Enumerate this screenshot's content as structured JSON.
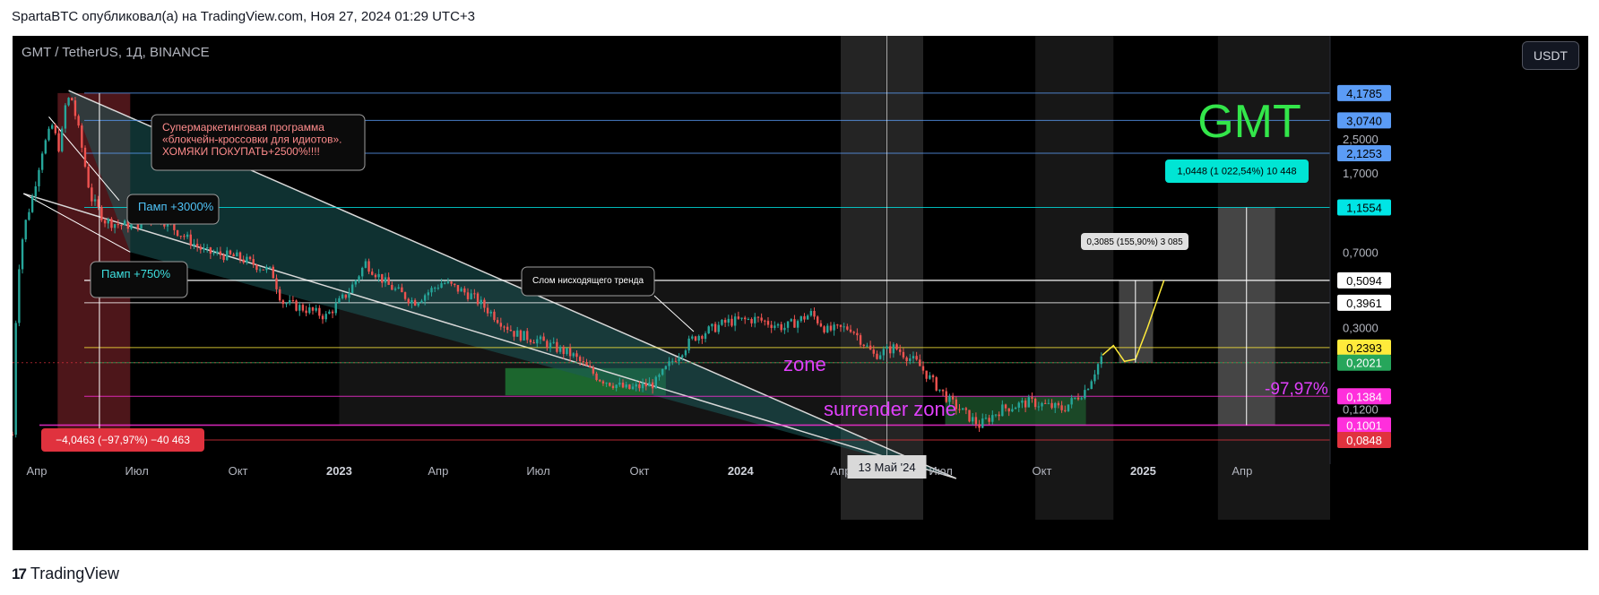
{
  "header": {
    "caption": "SpartaBTC опубликовал(а) на TradingView.com, Ноя 27, 2024 01:29 UTC+3"
  },
  "chart": {
    "symbol": "GMT / TetherUS, 1Д, BINANCE",
    "currency_button": "USDT",
    "watermark": "GMT"
  },
  "footer": {
    "brand": "TradingView",
    "logo_glyph": "17"
  },
  "colors": {
    "background": "#000000",
    "candle_up": "#26a69a",
    "candle_down": "#ef5350",
    "wedge_fill": "#1c5a5a",
    "accent_cyan": "#00e5d4",
    "accent_magenta": "#ff2fdc",
    "accent_yellow": "#ffeb3b",
    "label_blue": "#2962ff",
    "label_green": "#26a65b",
    "label_red": "#e0323e",
    "watermark_green": "#33e64a"
  },
  "chart_data": {
    "type": "line",
    "title": "GMT / TetherUS, 1Д, BINANCE",
    "yscale": "log",
    "ylim": [
      0.07,
      6.5
    ],
    "xlim": [
      "2022-03-10",
      "2025-06-20"
    ],
    "x_ticks": [
      "Апр",
      "Июл",
      "Окт",
      "2023",
      "Апр",
      "Июл",
      "Окт",
      "2024",
      "Апр",
      "Июл",
      "Окт",
      "2025",
      "Апр"
    ],
    "y_ticks": [
      "2,5000",
      "1,7000",
      "0,7000",
      "0,3000",
      "0,1200"
    ],
    "price_labels": [
      {
        "text": "4,1785",
        "value": 4.1785,
        "color": "#5b9cf6",
        "text_color": "#000000"
      },
      {
        "text": "3,0740",
        "value": 3.074,
        "color": "#5b9cf6",
        "text_color": "#000000"
      },
      {
        "text": "2,1253",
        "value": 2.1253,
        "color": "#5b9cf6",
        "text_color": "#000000"
      },
      {
        "text": "1,1554",
        "value": 1.1554,
        "color": "#00e5e5",
        "text_color": "#000000"
      },
      {
        "text": "0,5094",
        "value": 0.5094,
        "color": "#ffffff",
        "text_color": "#000000"
      },
      {
        "text": "0,3961",
        "value": 0.3961,
        "color": "#ffffff",
        "text_color": "#000000"
      },
      {
        "text": "0,2393",
        "value": 0.2393,
        "color": "#ffeb3b",
        "text_color": "#000000"
      },
      {
        "text": "0,2021",
        "value": 0.2021,
        "color": "#26a65b",
        "text_color": "#ffffff"
      },
      {
        "text": "0,1384",
        "value": 0.1384,
        "color": "#ff2fdc",
        "text_color": "#ffffff"
      },
      {
        "text": "0,1001",
        "value": 0.1001,
        "color": "#ff2fdc",
        "text_color": "#ffffff"
      },
      {
        "text": "0,0848",
        "value": 0.0848,
        "color": "#e0323e",
        "text_color": "#ffffff"
      }
    ],
    "price_path": [
      [
        "2022-03-10",
        0.09
      ],
      [
        "2022-03-14",
        0.5
      ],
      [
        "2022-03-20",
        0.9
      ],
      [
        "2022-03-28",
        1.3
      ],
      [
        "2022-04-06",
        2.2
      ],
      [
        "2022-04-15",
        2.9
      ],
      [
        "2022-04-22",
        2.2
      ],
      [
        "2022-04-27",
        3.6
      ],
      [
        "2022-05-02",
        4.1
      ],
      [
        "2022-05-10",
        2.6
      ],
      [
        "2022-05-20",
        1.3
      ],
      [
        "2022-06-02",
        1.0
      ],
      [
        "2022-06-15",
        0.95
      ],
      [
        "2022-06-30",
        0.95
      ],
      [
        "2022-07-20",
        1.05
      ],
      [
        "2022-08-10",
        0.86
      ],
      [
        "2022-09-01",
        0.7
      ],
      [
        "2022-10-01",
        0.66
      ],
      [
        "2022-11-01",
        0.56
      ],
      [
        "2022-11-10",
        0.4
      ],
      [
        "2022-12-01",
        0.37
      ],
      [
        "2022-12-20",
        0.34
      ],
      [
        "2023-01-10",
        0.45
      ],
      [
        "2023-01-25",
        0.62
      ],
      [
        "2023-02-15",
        0.48
      ],
      [
        "2023-03-10",
        0.4
      ],
      [
        "2023-04-05",
        0.5
      ],
      [
        "2023-05-01",
        0.43
      ],
      [
        "2023-06-10",
        0.28
      ],
      [
        "2023-07-01",
        0.26
      ],
      [
        "2023-08-01",
        0.22
      ],
      [
        "2023-08-25",
        0.17
      ],
      [
        "2023-09-20",
        0.15
      ],
      [
        "2023-10-15",
        0.16
      ],
      [
        "2023-11-01",
        0.21
      ],
      [
        "2023-11-20",
        0.27
      ],
      [
        "2023-12-20",
        0.32
      ],
      [
        "2024-01-15",
        0.33
      ],
      [
        "2024-02-10",
        0.3
      ],
      [
        "2024-03-05",
        0.35
      ],
      [
        "2024-03-20",
        0.29
      ],
      [
        "2024-04-10",
        0.3
      ],
      [
        "2024-05-01",
        0.22
      ],
      [
        "2024-05-20",
        0.24
      ],
      [
        "2024-06-10",
        0.2
      ],
      [
        "2024-06-25",
        0.16
      ],
      [
        "2024-07-10",
        0.13
      ],
      [
        "2024-08-05",
        0.1
      ],
      [
        "2024-08-25",
        0.12
      ],
      [
        "2024-09-20",
        0.13
      ],
      [
        "2024-10-20",
        0.12
      ],
      [
        "2024-11-10",
        0.15
      ],
      [
        "2024-11-25",
        0.22
      ]
    ],
    "projection_path": [
      [
        "2024-11-25",
        0.22
      ],
      [
        "2024-12-05",
        0.245
      ],
      [
        "2024-12-15",
        0.205
      ],
      [
        "2024-12-25",
        0.21
      ],
      [
        "2025-01-05",
        0.3
      ],
      [
        "2025-01-20",
        0.51
      ]
    ],
    "annotations": [
      {
        "text": "Супермаркетинговая программа «блокчейн-кроссовки для идиотов». ХОМЯКИ ПОКУПАТЬ+2500%!!!!",
        "color": "#ff8c8c"
      },
      {
        "text": "Памп +3000%",
        "color": "#4fc3f7"
      },
      {
        "text": "Памп +750%",
        "color": "#3ee0e0"
      },
      {
        "text": "Слом нисходящего тренда",
        "color": "#ffffff"
      },
      {
        "text": "zone",
        "color": "#e040fb"
      },
      {
        "text": "surrender zone",
        "color": "#e040fb"
      },
      {
        "text": "-97,97%",
        "color": "#e040fb"
      },
      {
        "text": "0,3085 (155,90%) 3 085",
        "color": "#000000"
      },
      {
        "text": "1,0448 (1 022,54%) 10 448",
        "color": "#000000"
      },
      {
        "text": "−4,0463 (−97,97%) −40 463",
        "color": "#ffffff"
      }
    ],
    "crosshair_label": "13 Май '24"
  }
}
